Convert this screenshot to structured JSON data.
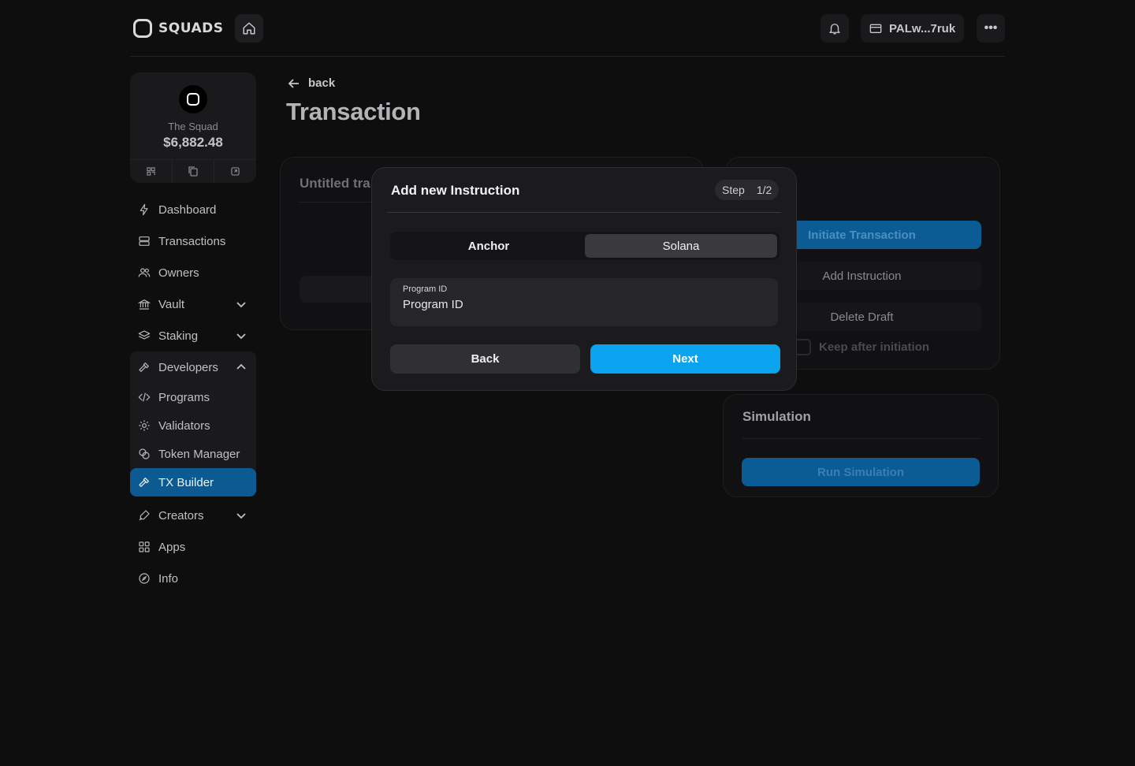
{
  "header": {
    "logo_text": "SQUADS",
    "wallet_label": "PALw...7ruk",
    "more_label": "•••",
    "icons": [
      "home-icon",
      "bell-icon",
      "wallet-icon",
      "more-icon"
    ]
  },
  "squad": {
    "name": "The Squad",
    "balance": "$6,882.48",
    "actions": [
      "qr-icon",
      "copy-icon",
      "external-icon"
    ]
  },
  "sidebar": {
    "items": [
      {
        "label": "Dashboard",
        "icon": "bolt-icon"
      },
      {
        "label": "Transactions",
        "icon": "stack-icon"
      },
      {
        "label": "Owners",
        "icon": "users-icon"
      },
      {
        "label": "Vault",
        "icon": "bank-icon",
        "expandable": true
      },
      {
        "label": "Staking",
        "icon": "layers-icon",
        "expandable": true
      },
      {
        "label": "Developers",
        "icon": "hammer-icon",
        "expanded": true
      },
      {
        "label": "Programs",
        "icon": "code-icon"
      },
      {
        "label": "Validators",
        "icon": "cog-icon"
      },
      {
        "label": "Token Manager",
        "icon": "coins-icon"
      },
      {
        "label": "TX Builder",
        "icon": "hammer-icon",
        "active": true
      },
      {
        "label": "Creators",
        "icon": "pen-icon",
        "expandable": true
      },
      {
        "label": "Apps",
        "icon": "grid-icon"
      },
      {
        "label": "Info",
        "icon": "compass-icon"
      }
    ]
  },
  "main": {
    "back_label": "back",
    "title": "Transaction",
    "draft_title": "Untitled tra",
    "actions": {
      "initiate": "Initiate Transaction",
      "add_instruction": "Add Instruction",
      "delete_draft": "Delete Draft",
      "keep_after": "Keep after initiation"
    },
    "simulation": {
      "title": "Simulation",
      "run": "Run Simulation"
    }
  },
  "modal": {
    "title": "Add new Instruction",
    "step_label": "Step",
    "step_value": "1/2",
    "tabs": [
      "Anchor",
      "Solana"
    ],
    "selected_tab": "Solana",
    "field_label": "Program ID",
    "field_placeholder": "Program ID",
    "back_label": "Back",
    "next_label": "Next"
  },
  "colors": {
    "accent": "#0aa3f0",
    "active_nav": "#0b5a91",
    "background": "#0e0e0f"
  }
}
